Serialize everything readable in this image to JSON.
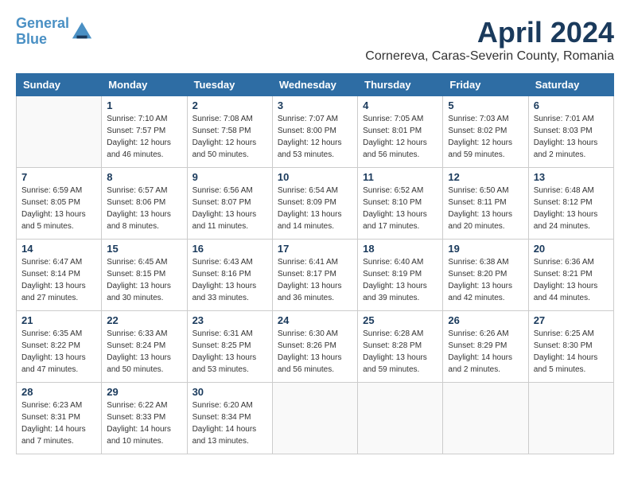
{
  "logo": {
    "line1": "General",
    "line2": "Blue"
  },
  "title": "April 2024",
  "subtitle": "Cornereva, Caras-Severin County, Romania",
  "days_of_week": [
    "Sunday",
    "Monday",
    "Tuesday",
    "Wednesday",
    "Thursday",
    "Friday",
    "Saturday"
  ],
  "weeks": [
    [
      {
        "day": "",
        "info": ""
      },
      {
        "day": "1",
        "info": "Sunrise: 7:10 AM\nSunset: 7:57 PM\nDaylight: 12 hours\nand 46 minutes."
      },
      {
        "day": "2",
        "info": "Sunrise: 7:08 AM\nSunset: 7:58 PM\nDaylight: 12 hours\nand 50 minutes."
      },
      {
        "day": "3",
        "info": "Sunrise: 7:07 AM\nSunset: 8:00 PM\nDaylight: 12 hours\nand 53 minutes."
      },
      {
        "day": "4",
        "info": "Sunrise: 7:05 AM\nSunset: 8:01 PM\nDaylight: 12 hours\nand 56 minutes."
      },
      {
        "day": "5",
        "info": "Sunrise: 7:03 AM\nSunset: 8:02 PM\nDaylight: 12 hours\nand 59 minutes."
      },
      {
        "day": "6",
        "info": "Sunrise: 7:01 AM\nSunset: 8:03 PM\nDaylight: 13 hours\nand 2 minutes."
      }
    ],
    [
      {
        "day": "7",
        "info": "Sunrise: 6:59 AM\nSunset: 8:05 PM\nDaylight: 13 hours\nand 5 minutes."
      },
      {
        "day": "8",
        "info": "Sunrise: 6:57 AM\nSunset: 8:06 PM\nDaylight: 13 hours\nand 8 minutes."
      },
      {
        "day": "9",
        "info": "Sunrise: 6:56 AM\nSunset: 8:07 PM\nDaylight: 13 hours\nand 11 minutes."
      },
      {
        "day": "10",
        "info": "Sunrise: 6:54 AM\nSunset: 8:09 PM\nDaylight: 13 hours\nand 14 minutes."
      },
      {
        "day": "11",
        "info": "Sunrise: 6:52 AM\nSunset: 8:10 PM\nDaylight: 13 hours\nand 17 minutes."
      },
      {
        "day": "12",
        "info": "Sunrise: 6:50 AM\nSunset: 8:11 PM\nDaylight: 13 hours\nand 20 minutes."
      },
      {
        "day": "13",
        "info": "Sunrise: 6:48 AM\nSunset: 8:12 PM\nDaylight: 13 hours\nand 24 minutes."
      }
    ],
    [
      {
        "day": "14",
        "info": "Sunrise: 6:47 AM\nSunset: 8:14 PM\nDaylight: 13 hours\nand 27 minutes."
      },
      {
        "day": "15",
        "info": "Sunrise: 6:45 AM\nSunset: 8:15 PM\nDaylight: 13 hours\nand 30 minutes."
      },
      {
        "day": "16",
        "info": "Sunrise: 6:43 AM\nSunset: 8:16 PM\nDaylight: 13 hours\nand 33 minutes."
      },
      {
        "day": "17",
        "info": "Sunrise: 6:41 AM\nSunset: 8:17 PM\nDaylight: 13 hours\nand 36 minutes."
      },
      {
        "day": "18",
        "info": "Sunrise: 6:40 AM\nSunset: 8:19 PM\nDaylight: 13 hours\nand 39 minutes."
      },
      {
        "day": "19",
        "info": "Sunrise: 6:38 AM\nSunset: 8:20 PM\nDaylight: 13 hours\nand 42 minutes."
      },
      {
        "day": "20",
        "info": "Sunrise: 6:36 AM\nSunset: 8:21 PM\nDaylight: 13 hours\nand 44 minutes."
      }
    ],
    [
      {
        "day": "21",
        "info": "Sunrise: 6:35 AM\nSunset: 8:22 PM\nDaylight: 13 hours\nand 47 minutes."
      },
      {
        "day": "22",
        "info": "Sunrise: 6:33 AM\nSunset: 8:24 PM\nDaylight: 13 hours\nand 50 minutes."
      },
      {
        "day": "23",
        "info": "Sunrise: 6:31 AM\nSunset: 8:25 PM\nDaylight: 13 hours\nand 53 minutes."
      },
      {
        "day": "24",
        "info": "Sunrise: 6:30 AM\nSunset: 8:26 PM\nDaylight: 13 hours\nand 56 minutes."
      },
      {
        "day": "25",
        "info": "Sunrise: 6:28 AM\nSunset: 8:28 PM\nDaylight: 13 hours\nand 59 minutes."
      },
      {
        "day": "26",
        "info": "Sunrise: 6:26 AM\nSunset: 8:29 PM\nDaylight: 14 hours\nand 2 minutes."
      },
      {
        "day": "27",
        "info": "Sunrise: 6:25 AM\nSunset: 8:30 PM\nDaylight: 14 hours\nand 5 minutes."
      }
    ],
    [
      {
        "day": "28",
        "info": "Sunrise: 6:23 AM\nSunset: 8:31 PM\nDaylight: 14 hours\nand 7 minutes."
      },
      {
        "day": "29",
        "info": "Sunrise: 6:22 AM\nSunset: 8:33 PM\nDaylight: 14 hours\nand 10 minutes."
      },
      {
        "day": "30",
        "info": "Sunrise: 6:20 AM\nSunset: 8:34 PM\nDaylight: 14 hours\nand 13 minutes."
      },
      {
        "day": "",
        "info": ""
      },
      {
        "day": "",
        "info": ""
      },
      {
        "day": "",
        "info": ""
      },
      {
        "day": "",
        "info": ""
      }
    ]
  ]
}
